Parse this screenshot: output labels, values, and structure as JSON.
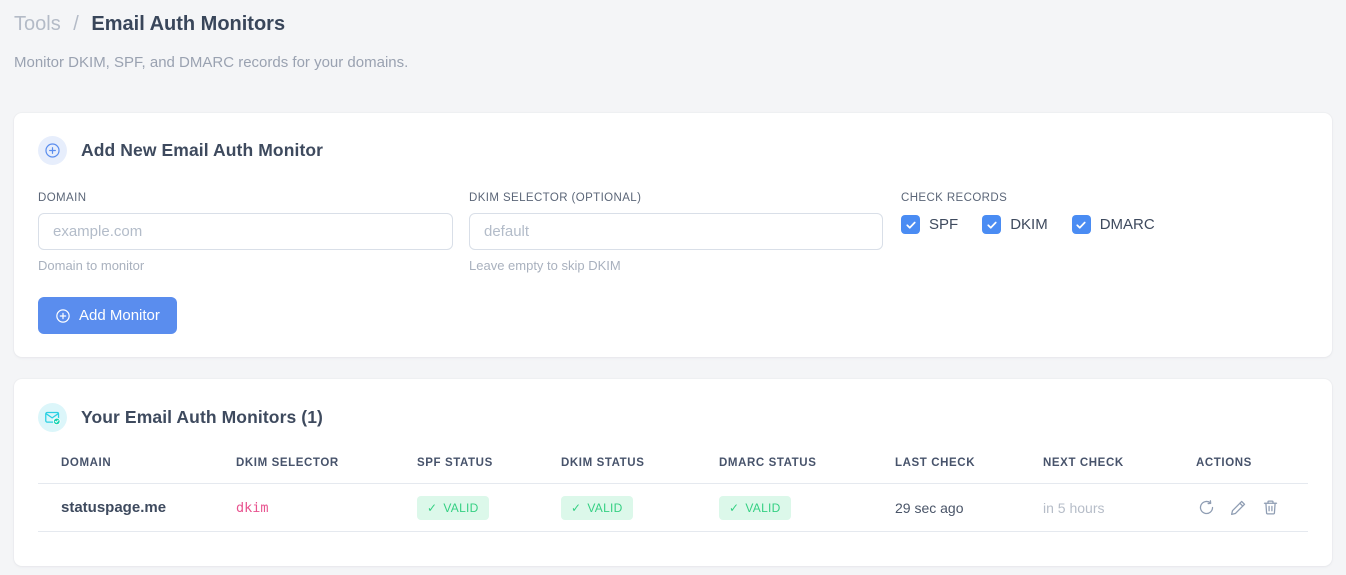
{
  "page": {
    "breadcrumb": {
      "section": "Tools",
      "separator": "/",
      "current": "Email Auth Monitors"
    },
    "subtitle": "Monitor DKIM, SPF, and DMARC records for your domains."
  },
  "add_monitor_card": {
    "title": "Add New Email Auth Monitor",
    "icon": "plus-circle-icon",
    "fields": {
      "domain": {
        "label": "DOMAIN",
        "placeholder": "example.com",
        "value": "",
        "helper": "Domain to monitor"
      },
      "dkim_selector": {
        "label": "DKIM SELECTOR (OPTIONAL)",
        "placeholder": "default",
        "value": "",
        "helper": "Leave empty to skip DKIM"
      }
    },
    "check_records": {
      "label": "CHECK RECORDS",
      "options": [
        {
          "label": "SPF",
          "checked": true
        },
        {
          "label": "DKIM",
          "checked": true
        },
        {
          "label": "DMARC",
          "checked": true
        }
      ]
    },
    "submit_label": "Add Monitor"
  },
  "monitors_card": {
    "title": "Your Email Auth Monitors (1)",
    "icon": "email-check-icon",
    "count": 1,
    "table": {
      "check_glyph": "✓",
      "headers": [
        "DOMAIN",
        "DKIM SELECTOR",
        "SPF STATUS",
        "DKIM STATUS",
        "DMARC STATUS",
        "LAST CHECK",
        "NEXT CHECK",
        "ACTIONS"
      ],
      "rows": [
        {
          "domain": "statuspage.me",
          "dkim_selector": "dkim",
          "spf_status": "VALID",
          "dkim_status": "VALID",
          "dmarc_status": "VALID",
          "last_check": "29 sec ago",
          "next_check": "in 5 hours",
          "actions": [
            "refresh",
            "edit",
            "delete"
          ]
        }
      ]
    }
  },
  "colors": {
    "accent_blue": "#5a8dee",
    "checkbox_blue": "#4a8cf3",
    "badge_green_bg": "#dcf8ea",
    "badge_green_text": "#35d083",
    "code_pink": "#e8538f",
    "icon_cyan": "#2bd0e2",
    "page_background": "#f4f5f7"
  }
}
